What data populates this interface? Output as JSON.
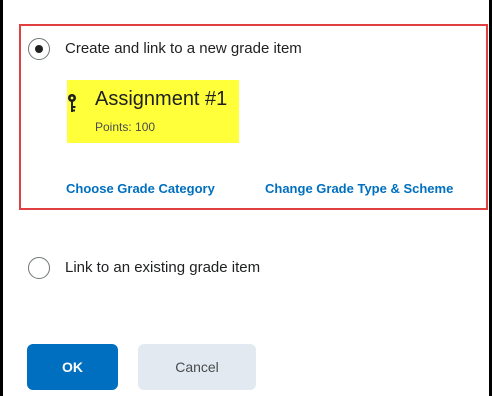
{
  "header": {
    "title_fragment": "...p..."
  },
  "options": {
    "new_item_label": "Create and link to a new grade item",
    "existing_item_label": "Link to an existing grade item",
    "selected": "new"
  },
  "grade_item": {
    "title": "Assignment #1",
    "points": "Points: 100",
    "icon": "key-icon"
  },
  "links": {
    "category": "Choose Grade Category",
    "type_scheme": "Change Grade Type & Scheme"
  },
  "buttons": {
    "ok": "OK",
    "cancel": "Cancel"
  },
  "colors": {
    "accent": "#006fbf",
    "highlight": "#ffff3a",
    "callout_border": "#e04040",
    "cancel_bg": "#e3e9f1"
  }
}
